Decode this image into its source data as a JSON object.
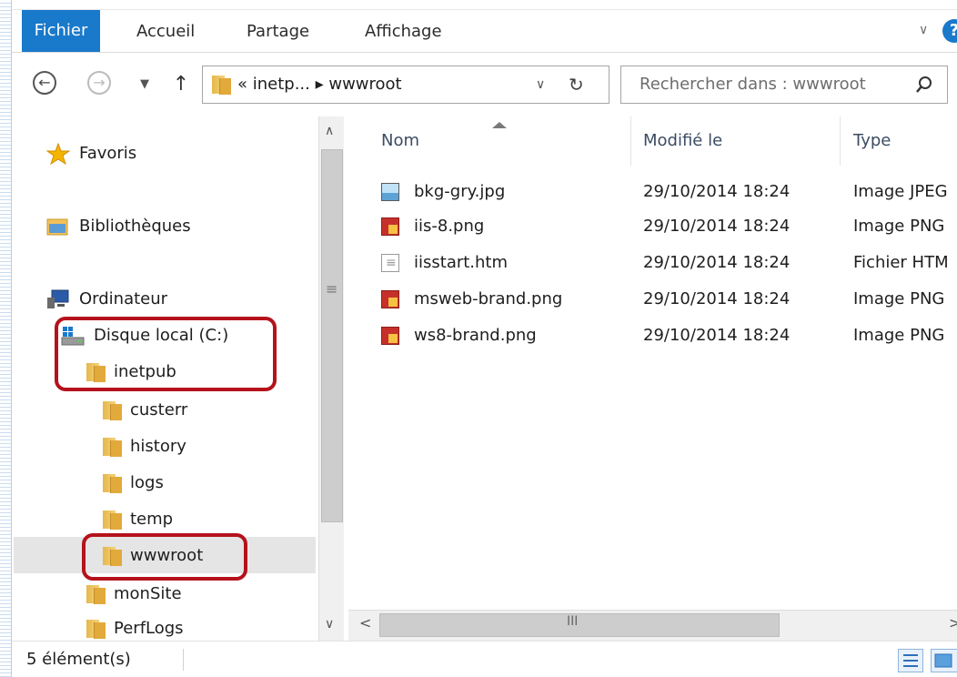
{
  "ribbon": {
    "tabs": [
      "Fichier",
      "Accueil",
      "Partage",
      "Affichage"
    ],
    "help_label": "?"
  },
  "address": {
    "breadcrumb": "« inetp... ▸ wwwroot"
  },
  "search": {
    "placeholder": "Rechercher dans : wwwroot"
  },
  "nav": {
    "favorites": "Favoris",
    "libraries": "Bibliothèques",
    "computer": "Ordinateur",
    "drive": "Disque local (C:)",
    "inetpub": "inetpub",
    "subfolders": [
      "custerr",
      "history",
      "logs",
      "temp",
      "wwwroot"
    ],
    "monsite": "monSite",
    "perflogs": "PerfLogs",
    "selected": "wwwroot"
  },
  "files": {
    "columns": [
      "Nom",
      "Modifié le",
      "Type"
    ],
    "rows": [
      {
        "name": "bkg-gry.jpg",
        "date": "29/10/2014 18:24",
        "type": "Image JPEG",
        "icon": "jpg-file-icon"
      },
      {
        "name": "iis-8.png",
        "date": "29/10/2014 18:24",
        "type": "Image PNG",
        "icon": "png-file-icon"
      },
      {
        "name": "iisstart.htm",
        "date": "29/10/2014 18:24",
        "type": "Fichier HTM",
        "icon": "htm-file-icon"
      },
      {
        "name": "msweb-brand.png",
        "date": "29/10/2014 18:24",
        "type": "Image PNG",
        "icon": "png-file-icon"
      },
      {
        "name": "ws8-brand.png",
        "date": "29/10/2014 18:24",
        "type": "Image PNG",
        "icon": "png-file-icon"
      }
    ]
  },
  "status": {
    "count": "5 élément(s)"
  },
  "colors": {
    "file_tab": "#1979ca",
    "highlight_box": "#b5121b",
    "selected_row": "#e5e5e5"
  }
}
